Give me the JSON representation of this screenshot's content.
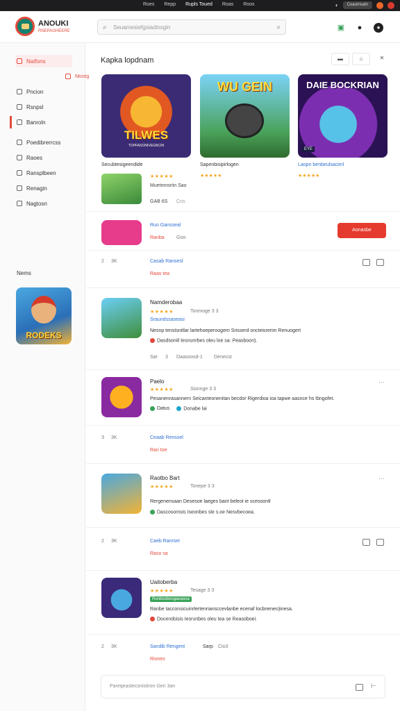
{
  "topbar": {
    "links": [
      "Roes",
      "Repp",
      "Rupls Toued",
      "Roas",
      "Roos"
    ],
    "pill": "Coaomsaln"
  },
  "header": {
    "brand": "ANOUKI",
    "brand_sub": "RNEPAGHEERE",
    "search_placeholder": "Seuamesiefgsiadinsgin"
  },
  "sidebar": {
    "items": [
      {
        "label": "Natfons"
      },
      {
        "label": "Ntostg"
      },
      {
        "label": "Pncion"
      },
      {
        "label": "Rsnpsl"
      },
      {
        "label": "Banroln"
      },
      {
        "label": "Poedibrerrcss"
      },
      {
        "label": "Raoes"
      },
      {
        "label": "Ransplbeen"
      },
      {
        "label": "Renagin"
      },
      {
        "label": "Nagtosn"
      }
    ],
    "section_title": "Nems",
    "featured_word": "RODEKS"
  },
  "main": {
    "section_title": "Kapka lopdnam",
    "banners": [
      {
        "word": "TILWES",
        "sub": "TOPFASONIVEGNCIN",
        "caption": "Secubtesigeendide"
      },
      {
        "word": "WU GEIN",
        "caption": "Sapenbisipirlogen"
      },
      {
        "word": "DAIE BOCKRIAN",
        "badge": "EYE",
        "caption": "Laopn benbeulsaciml"
      }
    ],
    "mini": {
      "title": "Muetmnsriin Sao",
      "meta": "GAB 6S",
      "meta2": "Cns"
    },
    "promo": {
      "title": "Ruo Gansseal",
      "subtitle": "Ranba",
      "meta": "Goo",
      "button": "Aonasbe"
    },
    "rows": [
      {
        "count": "2",
        "unit": "3K",
        "link": "Casab Ransesl",
        "sub": "Raas tea"
      },
      {
        "name": "Namderobaa",
        "rating": "Tonmoge 3 3",
        "tag": "Sraundssaseasi",
        "desc": "Nesnp tenstsnitlar lartehoeperoogem Srisserd oncteisrerim Renuogert",
        "desc2": "Dasdsoniil tesnunrbes oleu loe sa: Peasboon).",
        "stats": [
          "Sar",
          "3",
          "Daasoosd-1",
          "Denecst"
        ]
      },
      {
        "name": "Paelo",
        "rating": "Sisnnge 3 3",
        "desc": "Pesanenrasannern Seicanteonenitan becdor Rigerdioa ioa tapwe aasnce hs Ibngofet.",
        "chips": [
          "Datus",
          "Donabe lai"
        ]
      },
      {
        "count": "3",
        "unit": "3K",
        "link": "Ceaab Renssel",
        "sub": "Rari toe"
      },
      {
        "name": "Raotbo Bart",
        "rating": "Tonepe 3 3",
        "desc": "Rergenensaan Desesoe laeges bant beleot ie scesoontl",
        "desc2": "Dascosomsis Iseonbes sle s.oe Nesvbecoea."
      },
      {
        "count": "2",
        "unit": "3K",
        "link": "Caeb Ranrsei",
        "sub": "Raso sa"
      },
      {
        "name": "Uaitoberba",
        "rating": "Tesage 3 3",
        "tag": "Ronbeobesgaeasna",
        "desc": "Ranbe tacconsicuinrlertenriansccevlanbe ecenaf locbneneo)inesa.",
        "desc2": "Docendsisis Iesrunbes oleu tea se Reasoboei."
      },
      {
        "count": "2",
        "unit": "3K",
        "link": "Sandib Rengent",
        "link2": "Sarp",
        "link3": "Cio3",
        "sub": "Riones"
      }
    ],
    "comment_placeholder": "Pareqeastecsnistiron Gen 3an"
  },
  "colors": {
    "accent": "#e34a3b",
    "link": "#2d6fd1",
    "star": "#f5a623"
  }
}
